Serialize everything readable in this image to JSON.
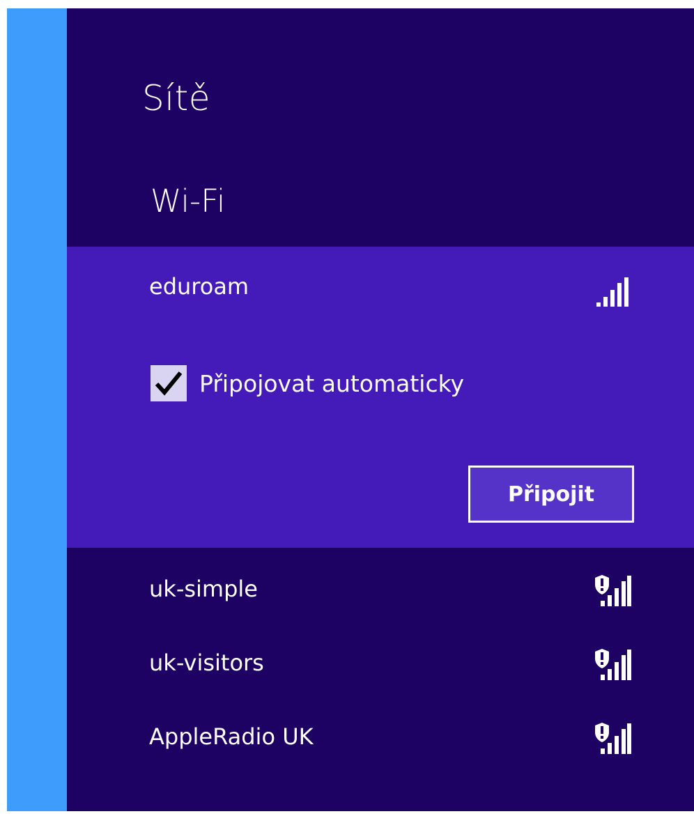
{
  "panel": {
    "title": "Sítě",
    "section_title": "Wi-Fi"
  },
  "selected_network": {
    "name": "eduroam",
    "signal_icon": "wifi-signal-icon",
    "auto_connect_label": "Připojovat automaticky",
    "auto_connect_checked": true,
    "connect_label": "Připojit"
  },
  "networks": [
    {
      "name": "uk-simple",
      "signal_icon": "wifi-secured-signal-icon"
    },
    {
      "name": "uk-visitors",
      "signal_icon": "wifi-secured-signal-icon"
    },
    {
      "name": "AppleRadio UK",
      "signal_icon": "wifi-secured-signal-icon"
    }
  ],
  "colors": {
    "desktop_accent": "#3e9cfc",
    "panel_background": "#1d0264",
    "selected_background": "#441ab8",
    "checkbox_fill": "#d9d4f2"
  }
}
